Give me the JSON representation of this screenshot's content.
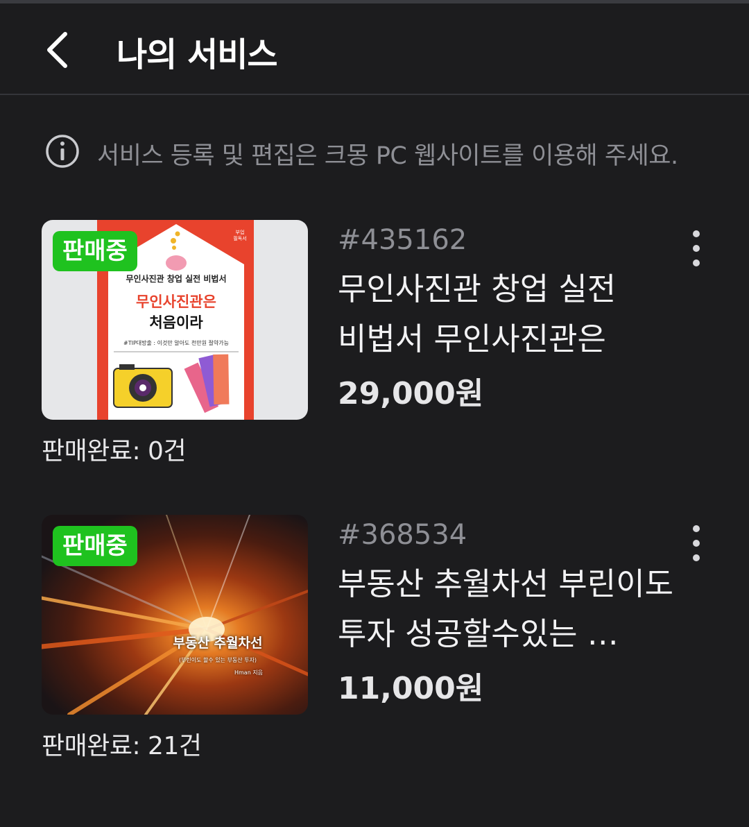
{
  "header": {
    "title": "나의 서비스"
  },
  "notice": {
    "text": "서비스 등록 및 편집은 크몽 PC 웹사이트를 이용해 주세요."
  },
  "colors": {
    "background": "#1c1c1e",
    "badge": "#1fc21f",
    "muted_text": "#8e8f95"
  },
  "services": [
    {
      "badge": "판매중",
      "code": "#435162",
      "title": "무인사진관 창업 실전 비법서 무인사진관은 처음…",
      "price": "29,000원",
      "sold": "판매완료: 0건",
      "thumbnail": {
        "line1": "무인사진관 창업 실전 비법서",
        "line2": "무인사진관은",
        "line3": "처음이라",
        "line4": "#TIP대방출 : 이것만 알아도 천만원 절약가능",
        "tag": "부업 필독서"
      }
    },
    {
      "badge": "판매중",
      "code": "#368534",
      "title": "부동산 추월차선 부린이도 투자 성공할수있는 …",
      "price": "11,000원",
      "sold": "판매완료: 21건",
      "thumbnail": {
        "title": "부동산 추월차선",
        "subtitle": "(부린이도 할수 있는 부동산 투자)",
        "author": "Hman 지음"
      }
    }
  ]
}
